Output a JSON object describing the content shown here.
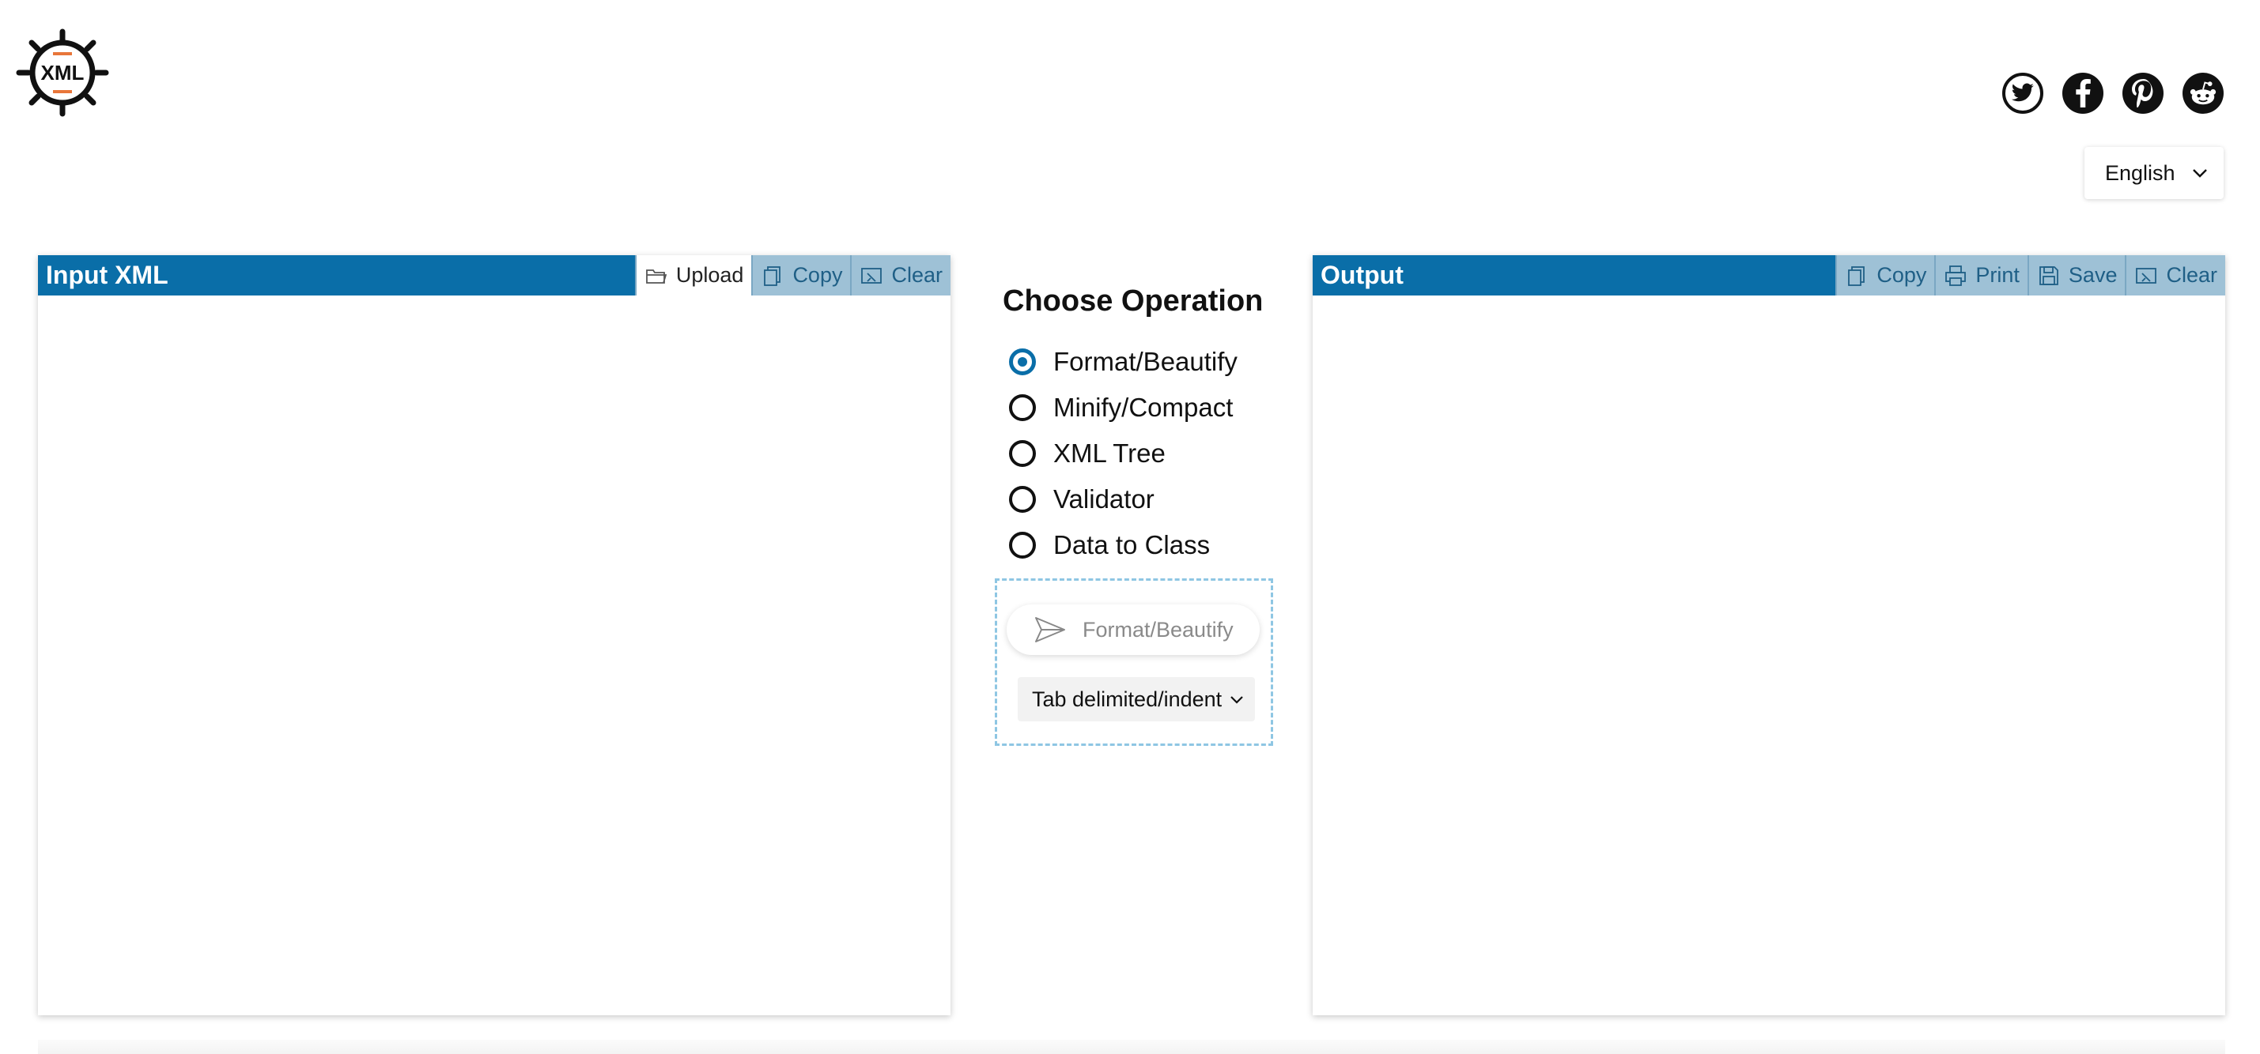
{
  "header": {
    "logo_text": "XML",
    "social": [
      {
        "name": "twitter-icon"
      },
      {
        "name": "facebook-icon"
      },
      {
        "name": "pinterest-icon"
      },
      {
        "name": "reddit-icon"
      }
    ],
    "language": "English"
  },
  "input_panel": {
    "title": "Input XML",
    "buttons": {
      "upload": "Upload",
      "copy": "Copy",
      "clear": "Clear"
    },
    "value": ""
  },
  "operations": {
    "title": "Choose Operation",
    "options": [
      {
        "label": "Format/Beautify",
        "selected": true
      },
      {
        "label": "Minify/Compact",
        "selected": false
      },
      {
        "label": "XML Tree",
        "selected": false
      },
      {
        "label": "Validator",
        "selected": false
      },
      {
        "label": "Data to Class",
        "selected": false
      }
    ],
    "run_label": "Format/Beautify",
    "indent_option": "Tab delimited/indent"
  },
  "output_panel": {
    "title": "Output",
    "buttons": {
      "copy": "Copy",
      "print": "Print",
      "save": "Save",
      "clear": "Clear"
    },
    "value": ""
  },
  "colors": {
    "accent": "#0a6ea8",
    "button_bg": "#9ec1d6",
    "logo_accent": "#e8763a"
  }
}
